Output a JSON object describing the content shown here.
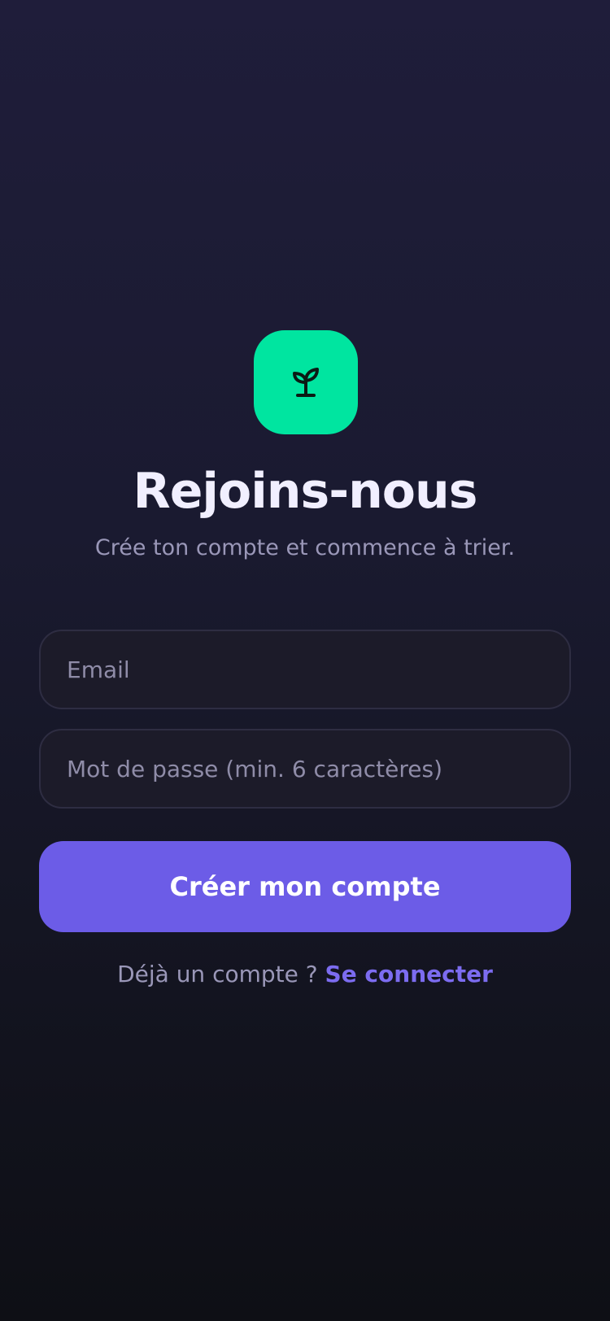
{
  "app": {
    "icon": "sprout-icon",
    "accent_color": "#00e5a0",
    "primary_color": "#6c5ce7"
  },
  "header": {
    "title": "Rejoins-nous",
    "subtitle": "Crée ton compte et commence à trier."
  },
  "form": {
    "email": {
      "placeholder": "Email",
      "value": ""
    },
    "password": {
      "placeholder": "Mot de passe (min. 6 caractères)",
      "value": ""
    },
    "submit_label": "Créer mon compte"
  },
  "footer": {
    "prompt": "Déjà un compte ?",
    "link_label": "Se connecter"
  }
}
